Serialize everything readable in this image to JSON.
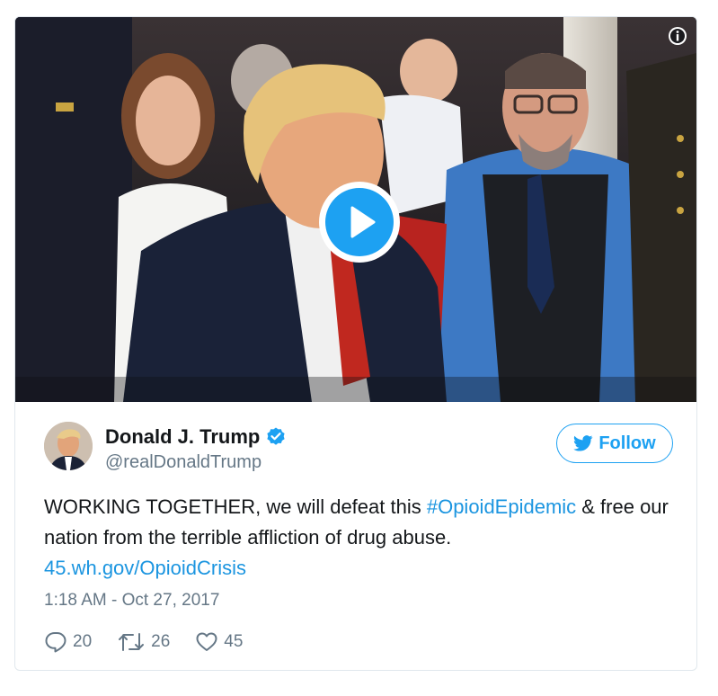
{
  "tweet": {
    "display_name": "Donald J. Trump",
    "handle": "@realDonaldTrump",
    "verified": true,
    "follow_label": "Follow",
    "text_part1": "WORKING TOGETHER, we will defeat this ",
    "hashtag": "#OpioidEpidemic",
    "text_part2": " & free our nation from the terrible affliction of drug abuse.",
    "link": "45.wh.gov/OpioidCrisis",
    "timestamp": "1:18 AM - Oct 27, 2017",
    "replies": "20",
    "retweets": "26",
    "likes": "45"
  },
  "colors": {
    "accent": "#1da1f2",
    "link": "#1b95e0",
    "text": "#14171a",
    "muted": "#657786",
    "border": "#e1e8ed"
  },
  "icons": {
    "info": "info-icon",
    "play": "play-icon",
    "verified": "verified-badge-icon",
    "follow": "twitter-bird-icon",
    "reply": "reply-icon",
    "retweet": "retweet-icon",
    "like": "heart-icon"
  }
}
